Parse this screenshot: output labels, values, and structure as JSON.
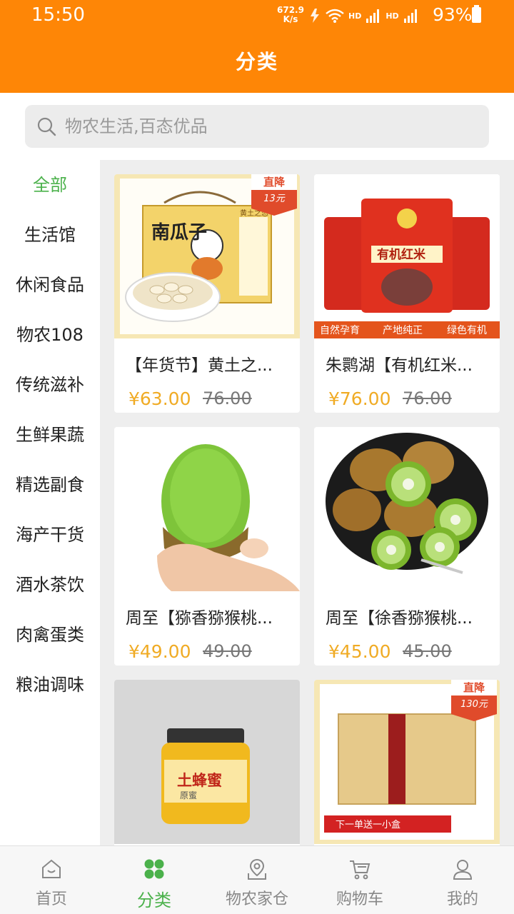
{
  "status_bar": {
    "time": "15:50",
    "net_rate": "672.9",
    "net_unit": "K/s",
    "hd1": "HD",
    "hd2": "HD",
    "battery": "93%"
  },
  "app_bar": {
    "title": "分类"
  },
  "search": {
    "placeholder": "物农生活,百态优品"
  },
  "sidebar": {
    "categories": [
      {
        "label": "全部"
      },
      {
        "label": "生活馆"
      },
      {
        "label": "休闲食品"
      },
      {
        "label": "物农108"
      },
      {
        "label": "传统滋补"
      },
      {
        "label": "生鲜果蔬"
      },
      {
        "label": "精选副食"
      },
      {
        "label": "海产干货"
      },
      {
        "label": "酒水茶饮"
      },
      {
        "label": "肉禽蛋类"
      },
      {
        "label": "粮油调味"
      }
    ]
  },
  "products": [
    {
      "name": "【年货节】黄土之...",
      "price": "¥63.00",
      "original": "76.00",
      "badge_top": "直降",
      "badge_amount": "13元",
      "box_label": "南瓜子",
      "box_brand": "黄土之恋"
    },
    {
      "name": "朱鹮湖【有机红米...",
      "price": "¥76.00",
      "original": "76.00",
      "bag_label": "有机红米",
      "tag1": "自然孕育",
      "tag2": "产地纯正",
      "tag3": "绿色有机"
    },
    {
      "name": "周至【猕香猕猴桃...",
      "price": "¥49.00",
      "original": "49.00"
    },
    {
      "name": "周至【徐香猕猴桃...",
      "price": "¥45.00",
      "original": "45.00"
    },
    {
      "jar_label": "土蜂蜜",
      "jar_sub": "原蜜"
    },
    {
      "badge_top": "直降",
      "badge_amount": "130元",
      "banner": "下一单送一小盒"
    }
  ],
  "tab_bar": {
    "items": [
      {
        "label": "首页",
        "icon": "home-icon"
      },
      {
        "label": "分类",
        "icon": "grid-icon"
      },
      {
        "label": "物农家仓",
        "icon": "location-icon"
      },
      {
        "label": "购物车",
        "icon": "cart-icon"
      },
      {
        "label": "我的",
        "icon": "user-icon"
      }
    ],
    "active_index": 1,
    "active_color": "#4bb14b"
  },
  "colors": {
    "brand": "#fe8606",
    "accent": "#4bb14b",
    "price": "#f0ab24"
  }
}
